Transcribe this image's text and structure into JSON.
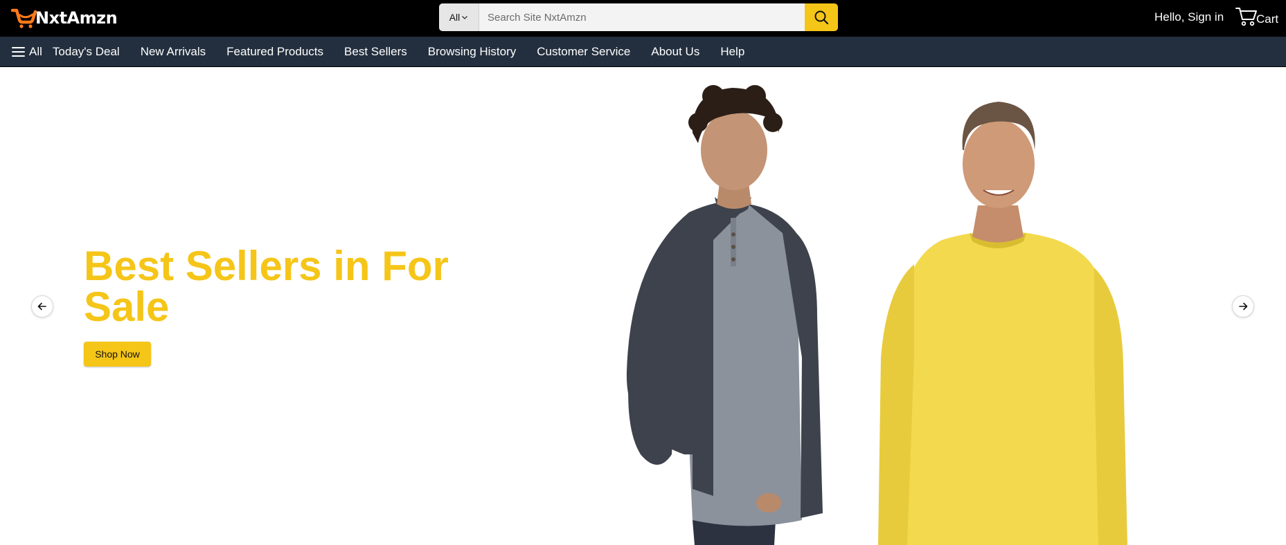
{
  "header": {
    "brand": "NxtAmzn",
    "logo_icon": "cart-logo-icon",
    "search": {
      "category": "All",
      "placeholder": "Search Site NxtAmzn",
      "value": "",
      "button_icon": "search-icon"
    },
    "signin_label": "Hello, Sign in",
    "cart_label": "Cart",
    "cart_icon": "cart-icon"
  },
  "nav": {
    "all_label": "All",
    "menu_icon": "menu-icon",
    "items": [
      {
        "label": "Today's Deal"
      },
      {
        "label": "New Arrivals"
      },
      {
        "label": "Featured Products"
      },
      {
        "label": "Best Sellers"
      },
      {
        "label": "Browsing History"
      },
      {
        "label": "Customer Service"
      },
      {
        "label": "About Us"
      },
      {
        "label": "Help"
      }
    ]
  },
  "hero": {
    "title": "Best Sellers in For Sale",
    "button_label": "Shop Now",
    "prev_icon": "arrow-left-icon",
    "next_icon": "arrow-right-icon"
  },
  "colors": {
    "topbar": "#000000",
    "navbar": "#232f3e",
    "accent": "#f5c518",
    "logo": "#ff7a1a"
  }
}
